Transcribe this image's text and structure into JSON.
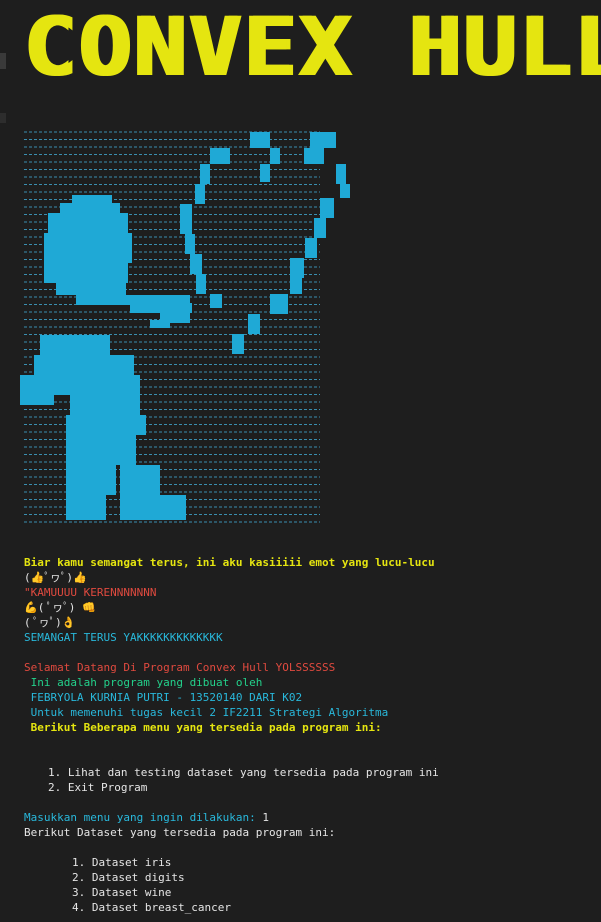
{
  "banner": {
    "title": "CONVEX HULL"
  },
  "colors": {
    "background": "#1e1e1e",
    "yellow": "#e5e510",
    "cyan": "#1fa9d6",
    "red": "#e04a3f",
    "green": "#23d18b",
    "blue": "#29b8db"
  },
  "motivation": {
    "line1": "Biar kamu semangat terus, ini aku kasiiiii emot yang lucu-lucu",
    "line2": "(👍ﾟヮﾟ)👍",
    "line3": "\"KAMUUUU KERENNNNNNN",
    "line4": "💪( ﾟヮﾟ) 👊",
    "line5": "( ﾟヮﾟ)👌",
    "line6": "SEMANGAT TERUS YAKKKKKKKKKKKKK"
  },
  "welcome": {
    "line1": "Selamat Datang Di Program Convex Hull YOLSSSSSS",
    "line2": " Ini adalah program yang dibuat oleh",
    "line3": " FEBRYOLA KURNIA PUTRI - 13520140 DARI K02",
    "line4": " Untuk memenuhi tugas kecil 2 IF2211 Strategi Algoritma",
    "line5": " Berikut Beberapa menu yang tersedia pada program ini:"
  },
  "menu": {
    "item1": "1. Lihat dan testing dataset yang tersedia pada program ini",
    "item2": "2. Exit Program"
  },
  "prompt": {
    "label": "Masukkan menu yang ingin dilakukan: ",
    "value": "1"
  },
  "datasets": {
    "heading": "Berikut Dataset yang tersedia pada program ini:",
    "items": [
      "1. Dataset iris",
      "2. Dataset digits",
      "3. Dataset wine",
      "4. Dataset breast_cancer"
    ]
  }
}
